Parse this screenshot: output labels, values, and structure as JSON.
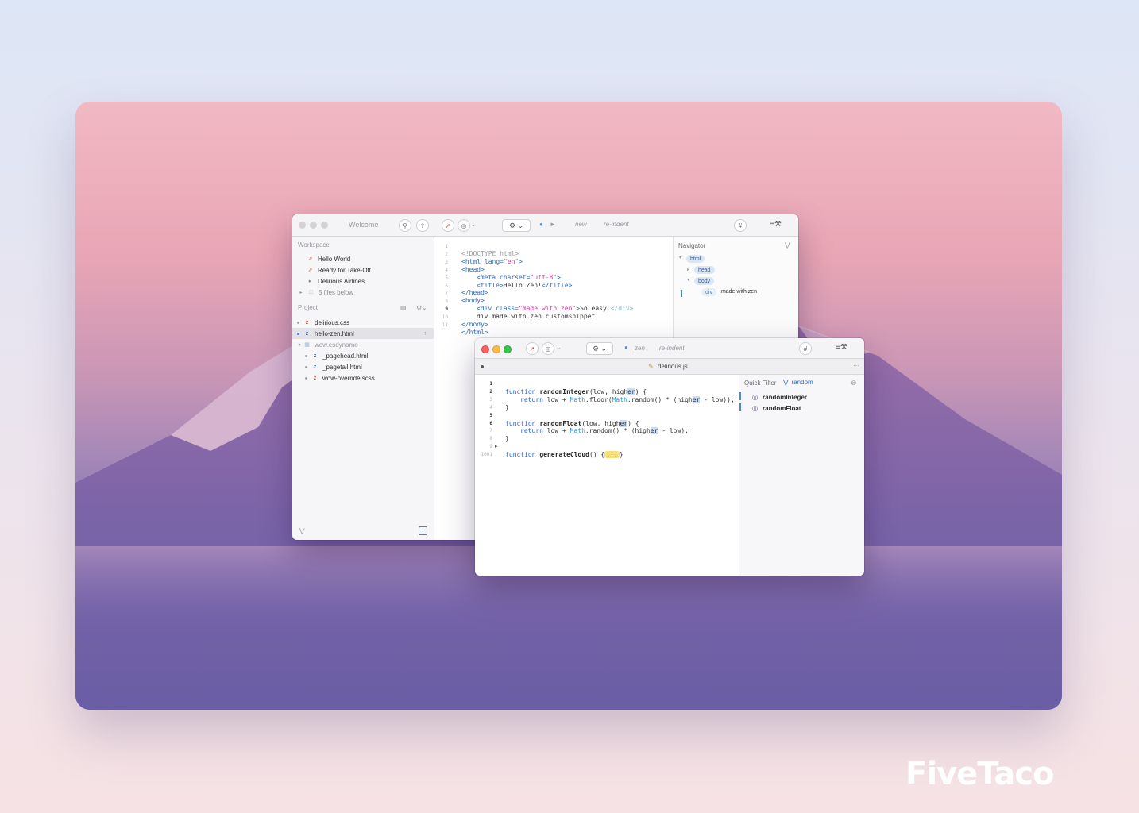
{
  "brand": "FiveTaco",
  "window1": {
    "title": "Welcome",
    "toolbar": {
      "new_label": "new",
      "reindent_label": "re-indent",
      "hash_label": "#"
    },
    "workspace": {
      "label": "Workspace",
      "items": [
        {
          "label": "Hello World"
        },
        {
          "label": "Ready for Take-Off"
        },
        {
          "label": "Delirious Airlines"
        },
        {
          "label": "5 files below"
        }
      ]
    },
    "project": {
      "label": "Project",
      "files": [
        {
          "label": "delirious.css"
        },
        {
          "label": "hello-zen.html"
        },
        {
          "label": "wow.esdynamo"
        },
        {
          "label": "_pagehead.html"
        },
        {
          "label": "_pagetail.html"
        },
        {
          "label": "wow-override.scss"
        }
      ]
    },
    "navigator": {
      "label": "Navigator",
      "nodes": {
        "html": "html",
        "head": "head",
        "body": "body",
        "div": "div",
        "div_class": ".made.with.zen"
      }
    },
    "code": {
      "line_numbers": [
        "1",
        "2",
        "3",
        "4",
        "5",
        "6",
        "7",
        "8",
        "9",
        "10",
        "11"
      ],
      "l1": "<!DOCTYPE html>",
      "l2a": "<html lang=",
      "l2b": "\"en\"",
      "l2c": ">",
      "l3": "<head>",
      "l4a": "<meta charset=",
      "l4b": "\"utf-8\"",
      "l4c": ">",
      "l5a": "<title>",
      "l5b": "Hello Zen!",
      "l5c": "</title>",
      "l6": "</head>",
      "l7": "<body>",
      "l8a": "<div class=",
      "l8b": "\"made with zen\"",
      "l8c": ">",
      "l8d": "So easy.",
      "l8e": "</div>",
      "l9": "div.made.with.zen customsnippet",
      "l10": "</body>",
      "l11": "</html>"
    }
  },
  "window2": {
    "doc_title": "delirious.js",
    "toolbar": {
      "zen_label": "zen",
      "reindent_label": "re-indent",
      "hash_label": "#"
    },
    "quick_filter": {
      "label": "Quick Filter",
      "value": "random"
    },
    "symbols": [
      {
        "label": "randomInteger"
      },
      {
        "label": "randomFloat"
      }
    ],
    "code": {
      "line_numbers": [
        "1",
        "2",
        "3",
        "4",
        "5",
        "6",
        "7",
        "8",
        "9",
        "1001"
      ],
      "f1_kw": "function",
      "f1_name": "randomInteger",
      "f1_args_a": "(low, high",
      "f1_args_hl": "er",
      "f1_args_b": ") {",
      "r1_kw": "return",
      "r1_a": " low + ",
      "r1_cls1": "Math",
      "r1_b": ".floor(",
      "r1_cls2": "Math",
      "r1_c": ".random() * (high",
      "r1_hl": "er",
      "r1_d": " - low));",
      "close1": "}",
      "f2_kw": "function",
      "f2_name": "randomFloat",
      "f2_args_a": "(low, high",
      "f2_args_hl": "er",
      "f2_args_b": ") {",
      "r2_kw": "return",
      "r2_a": " low + ",
      "r2_cls": "Math",
      "r2_b": ".random() * (high",
      "r2_hl": "er",
      "r2_c": " - low);",
      "close2": "}",
      "f3_kw": "function",
      "f3_name": "generateCloud",
      "f3_args": "() {",
      "f3_fold": "...",
      "f3_close": "}"
    }
  }
}
